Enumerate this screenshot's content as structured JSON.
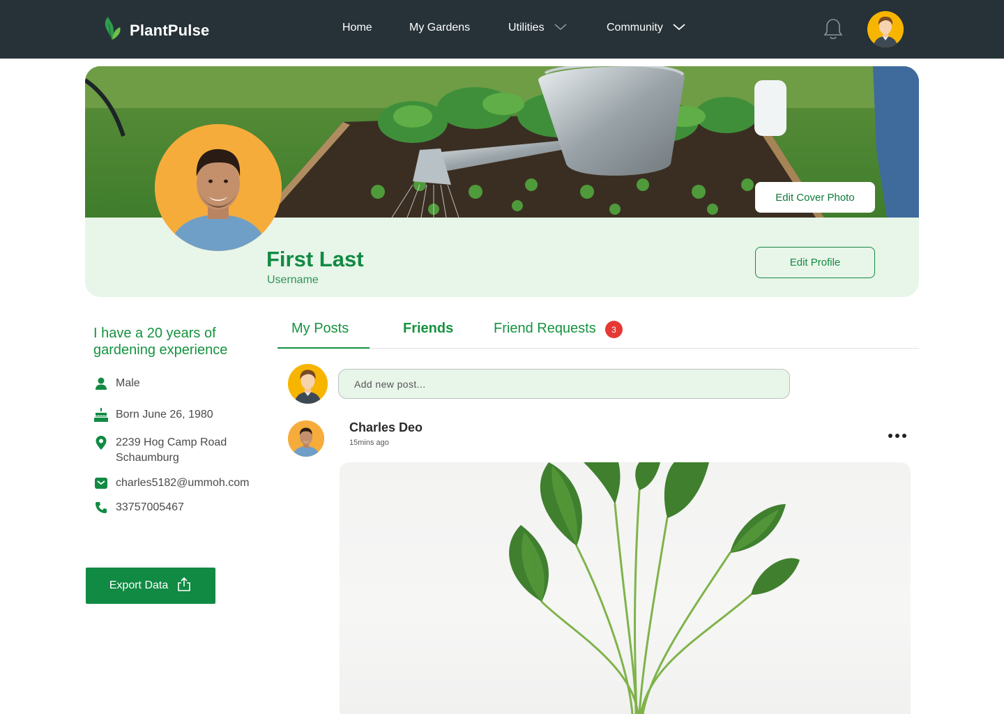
{
  "app": {
    "name": "PlantPulse"
  },
  "nav": {
    "items": [
      {
        "label": "Home"
      },
      {
        "label": "My Gardens"
      },
      {
        "label": "Utilities"
      },
      {
        "label": "Community"
      }
    ]
  },
  "profile": {
    "edit_cover_label": "Edit Cover Photo",
    "name": "First Last",
    "username": "Username",
    "edit_profile_label": "Edit Profile"
  },
  "about": {
    "bio": "I have a 20 years of gardening experience",
    "gender": "Male",
    "birthday": "Born June 26, 1980",
    "address_line1": "2239  Hog Camp Road",
    "address_line2": "Schaumburg",
    "email": "charles5182@ummoh.com",
    "phone": "33757005467",
    "export_label": "Export Data"
  },
  "tabs": [
    {
      "label": "My Posts"
    },
    {
      "label": "Friends"
    },
    {
      "label": "Friend Requests"
    }
  ],
  "friend_requests_count": "3",
  "composer": {
    "placeholder": "Add new post..."
  },
  "post": {
    "author": "Charles Deo",
    "time": "15mins ago"
  },
  "colors": {
    "navbar": "#263238",
    "accent": "#118a43",
    "light_green": "#e8f5e9",
    "badge": "#e53935",
    "avatar_bg": "#f7b500"
  }
}
